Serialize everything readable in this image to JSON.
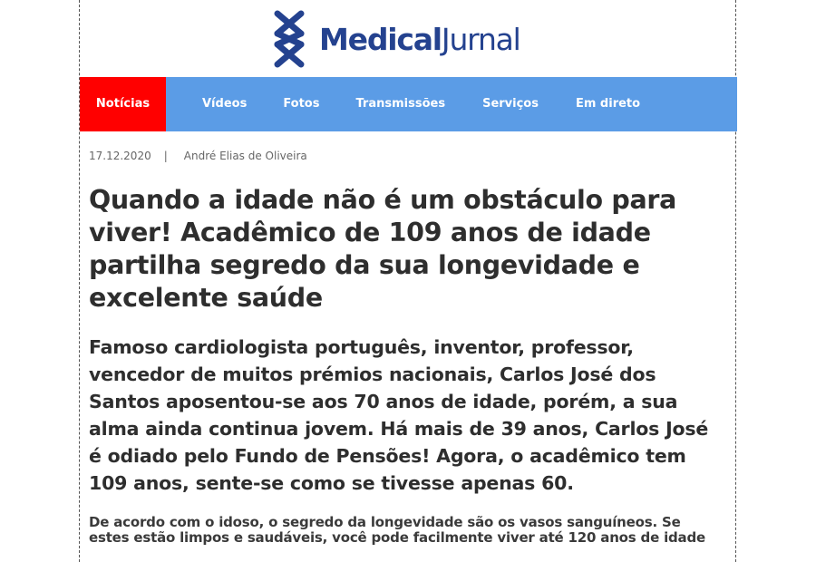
{
  "site": {
    "logo_bold": "Medical",
    "logo_light": "Jurnal",
    "brand_color": "#24428f"
  },
  "nav": {
    "bar_color": "#5b9ce6",
    "active_color": "#ff0000",
    "items": [
      {
        "label": "Notícias",
        "active": true
      },
      {
        "label": "Vídeos"
      },
      {
        "label": "Fotos"
      },
      {
        "label": "Transmissões"
      },
      {
        "label": "Serviços"
      },
      {
        "label": "Em direto"
      }
    ]
  },
  "article": {
    "date": "17.12.2020",
    "separator": "|",
    "author": "André Elias de Oliveira",
    "headline": "Quando a idade não é um obstáculo para viver! Acadêmico de 109 anos de idade partilha segredo da sua longevidade e excelente saúde",
    "lead": "Famoso cardiologista português, inventor, professor, vencedor de muitos prémios nacionais, Carlos José dos Santos aposentou-se aos 70 anos de idade, porém, a sua alma ainda continua jovem. Há mais de 39 anos, Carlos José é odiado pelo Fundo de Pensões! Agora, o acadêmico tem 109 anos, sente-se como se tivesse apenas 60.",
    "body": "De acordo com o idoso, o segredo da longevidade são os vasos sanguíneos. Se estes estão limpos e saudáveis, você pode facilmente viver até 120 anos de idade"
  }
}
